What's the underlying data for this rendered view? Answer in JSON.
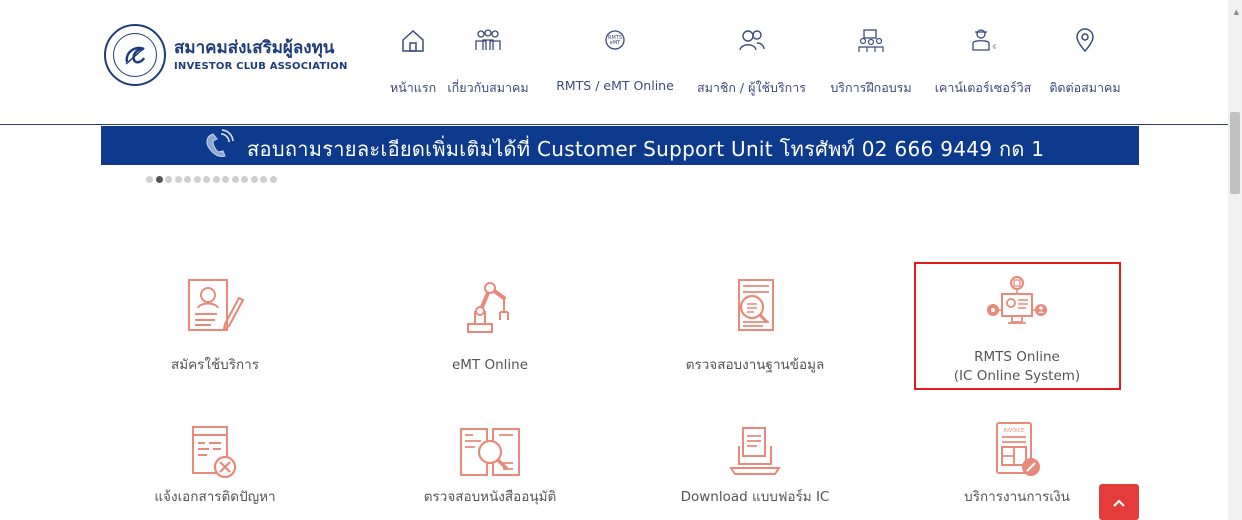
{
  "header": {
    "logo_th": "สมาคมส่งเสริมผู้ลงทุน",
    "logo_en": "INVESTOR CLUB ASSOCIATION"
  },
  "nav": [
    {
      "label": "หน้าแรก",
      "icon": "home-icon"
    },
    {
      "label": "เกี่ยวกับสมาคม",
      "icon": "people-group-icon"
    },
    {
      "label": "RMTS / eMT Online",
      "icon": "rmts-emt-icon"
    },
    {
      "label": "สมาชิก / ผู้ใช้บริการ",
      "icon": "members-icon"
    },
    {
      "label": "บริการฝึกอบรม",
      "icon": "training-icon"
    },
    {
      "label": "เคาน์เตอร์เซอร์วิส",
      "icon": "counter-service-icon"
    },
    {
      "label": "ติดต่อสมาคม",
      "icon": "location-pin-icon"
    }
  ],
  "banner": {
    "text": "สอบถามรายละเอียดเพิ่มเติมได้ที่ Customer Support Unit โทรศัพท์ 02 666 9449 กด 1",
    "icon": "phone-icon"
  },
  "carousel": {
    "total_dots": 14,
    "active_index": 1
  },
  "services": [
    {
      "label": "สมัครใช้บริการ",
      "icon": "application-form-icon"
    },
    {
      "label": "eMT Online",
      "icon": "robot-arm-icon"
    },
    {
      "label": "ตรวจสอบงานฐานข้อมูล",
      "icon": "document-search-icon"
    },
    {
      "label": "RMTS Online",
      "label2": "(IC Online System)",
      "icon": "online-system-icon"
    },
    {
      "label": "แจ้งเอกสารติดปัญหา",
      "icon": "document-error-icon"
    },
    {
      "label": "ตรวจสอบหนังสืออนุมัติ",
      "icon": "book-search-icon"
    },
    {
      "label": "Download แบบฟอร์ม IC",
      "icon": "download-form-icon"
    },
    {
      "label": "บริการงานการเงิน",
      "icon": "invoice-icon"
    }
  ],
  "colors": {
    "brand_navy": "#1e3c7a",
    "banner_blue": "#0d3a8c",
    "icon_salmon": "#e8897a",
    "highlight_red": "#e21b1b",
    "to_top_red": "#e43b3b"
  }
}
